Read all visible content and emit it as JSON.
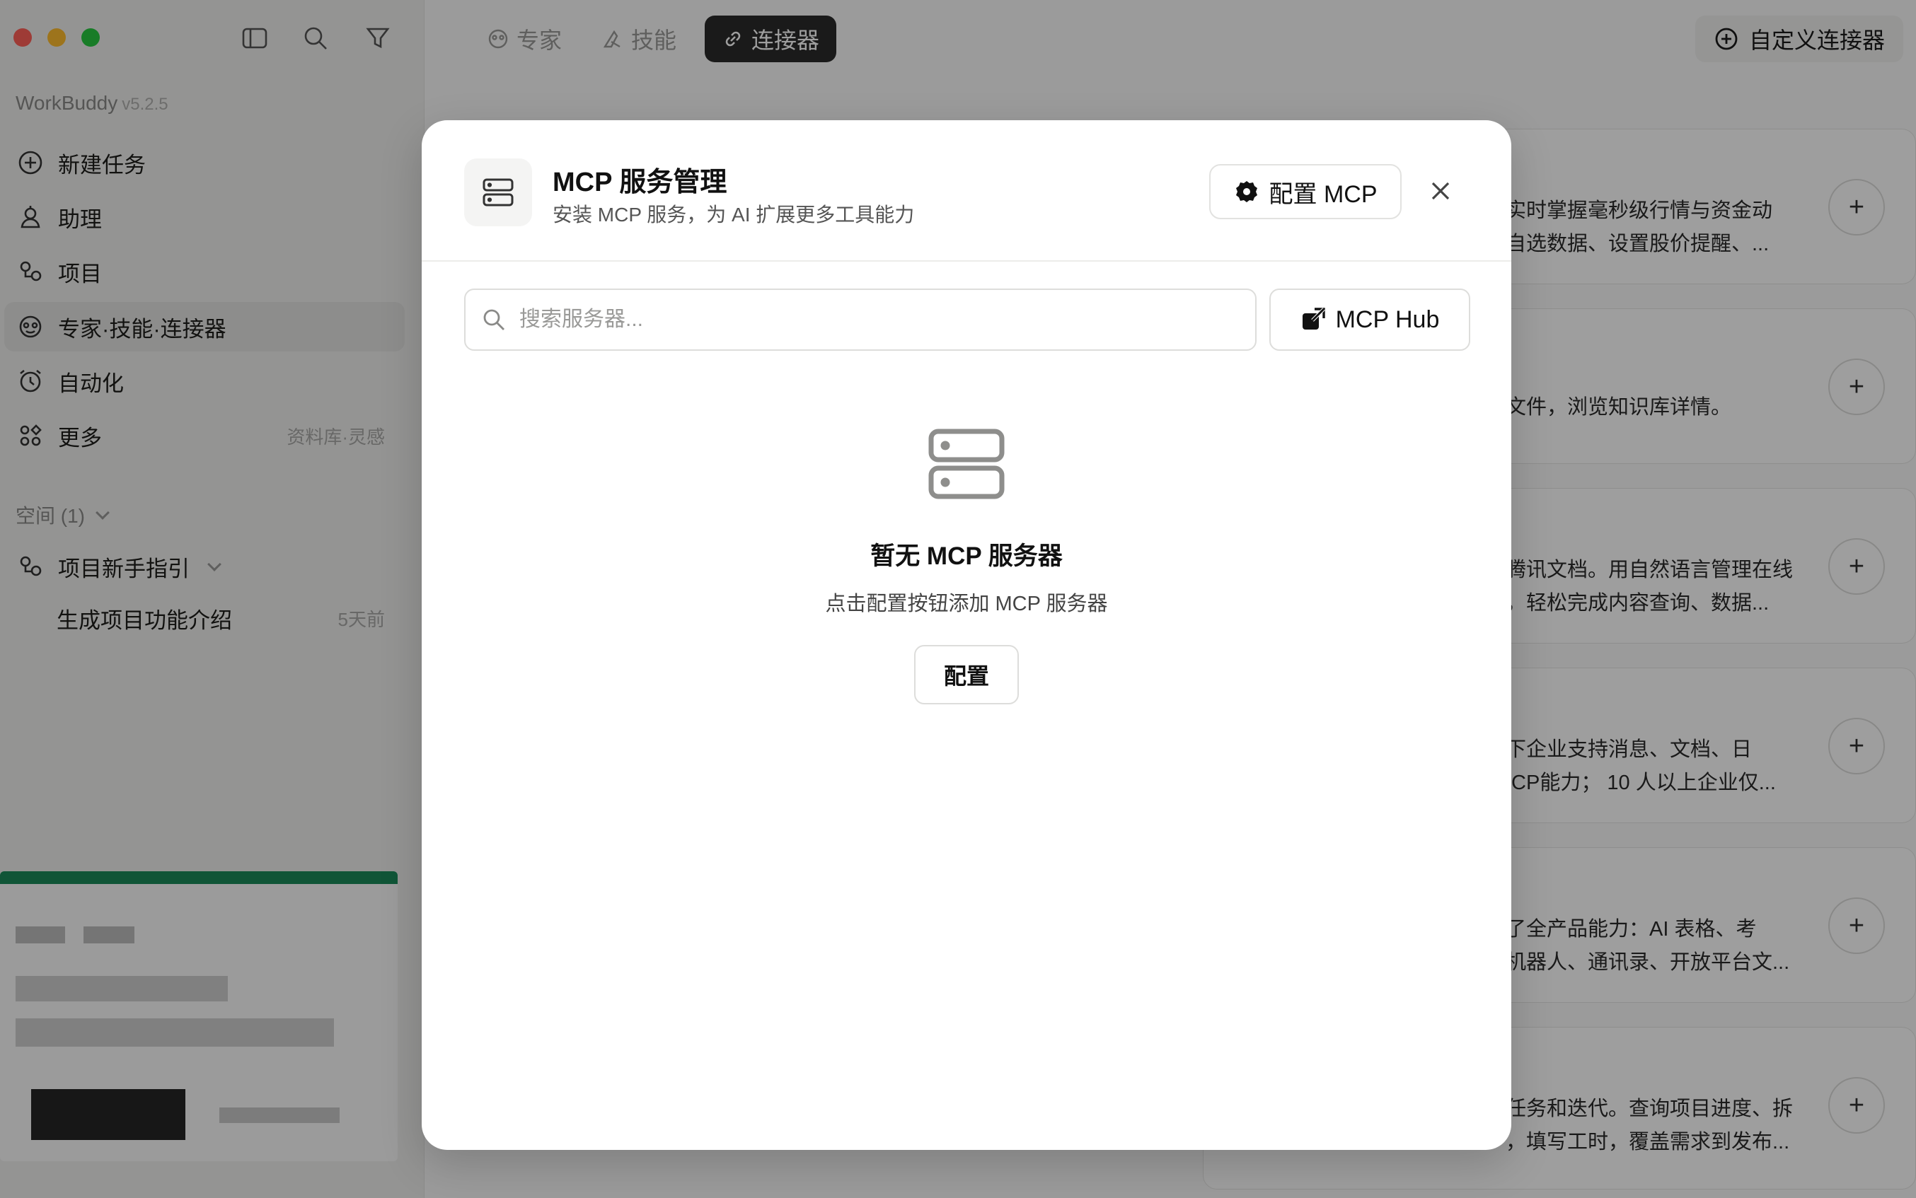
{
  "app": {
    "name": "WorkBuddy",
    "version": "v5.2.5"
  },
  "sidebar": {
    "items": [
      {
        "label": "新建任务",
        "icon": "plus-circle-icon"
      },
      {
        "label": "助理",
        "icon": "assistant-icon"
      },
      {
        "label": "项目",
        "icon": "project-icon"
      },
      {
        "label": "专家·技能·连接器",
        "icon": "expert-icon",
        "active": true
      },
      {
        "label": "自动化",
        "icon": "automation-clock-icon"
      },
      {
        "label": "更多",
        "icon": "more-grid-icon",
        "hint": "资料库·灵感"
      }
    ],
    "space_label": "空间 (1)",
    "project": {
      "label": "项目新手指引",
      "icon": "project-icon"
    },
    "task": {
      "label": "生成项目功能介绍",
      "time": "5天前"
    }
  },
  "tabs": [
    {
      "label": "专家",
      "icon": "expert-icon"
    },
    {
      "label": "技能",
      "icon": "skill-icon"
    },
    {
      "label": "连接器",
      "icon": "link-icon",
      "active": true
    }
  ],
  "header": {
    "custom_connector_label": "自定义连接器"
  },
  "connectors": [
    {
      "line1": "实时掌握毫秒级行情与资金动",
      "line2": "自选数据、设置股价提醒、..."
    },
    {
      "line1": "文件，浏览知识库详情。",
      "line2": ""
    },
    {
      "line1": "腾讯文档。用自然语言管理在线",
      "line2": "，轻松完成内容查询、数据..."
    },
    {
      "line1": "下企业支持消息、文档、日",
      "line2": "ICP能力； 10 人以上企业仅..."
    },
    {
      "line1": "了全产品能力：AI 表格、考",
      "line2": "机器人、通讯录、开放平台文..."
    },
    {
      "line1": "任务和迭代。查询项目进度、拆",
      "line2": "，填写工时，覆盖需求到发布..."
    }
  ],
  "modal": {
    "title": "MCP 服务管理",
    "subtitle": "安装 MCP 服务，为 AI 扩展更多工具能力",
    "configure_mcp_label": "配置 MCP",
    "search_placeholder": "搜索服务器...",
    "hub_label": "MCP Hub",
    "empty_title": "暂无 MCP 服务器",
    "empty_subtitle": "点击配置按钮添加 MCP 服务器",
    "configure_label": "配置"
  },
  "colors": {
    "accent_dark": "#2b2b2a",
    "traffic_red": "#ff5f57",
    "traffic_yellow": "#febc2e",
    "traffic_green": "#28c840"
  }
}
